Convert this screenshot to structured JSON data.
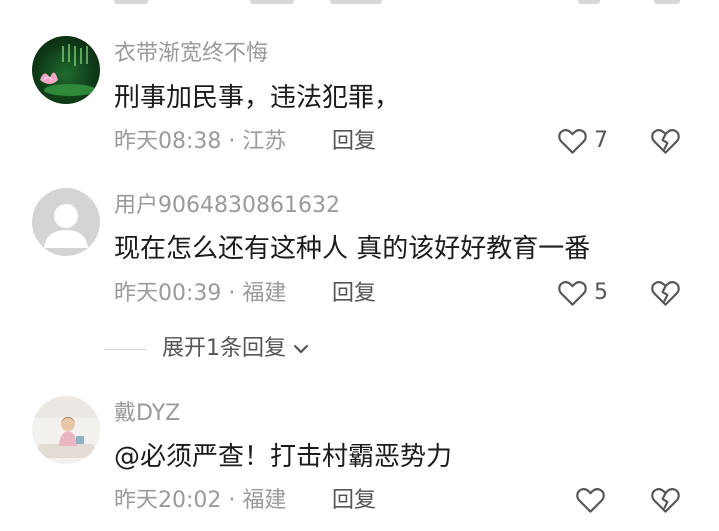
{
  "comments": [
    {
      "username": "衣带渐宽终不悔",
      "content": "刑事加民事，违法犯罪，",
      "time": "昨天08:38",
      "location": "江苏",
      "reply_label": "回复",
      "like_count": "7"
    },
    {
      "username": "用户9064830861632",
      "content": "现在怎么还有这种人 真的该好好教育一番",
      "time": "昨天00:39",
      "location": "福建",
      "reply_label": "回复",
      "like_count": "5",
      "expand_label": "展开1条回复"
    },
    {
      "username": "戴DYZ",
      "content": "@必须严查！打击村霸恶势力",
      "time": "昨天20:02",
      "location": "福建",
      "reply_label": "回复",
      "like_count": ""
    }
  ],
  "separator": " · ",
  "icons": {
    "like": "heart-outline-icon",
    "dislike": "broken-heart-icon",
    "expand": "chevron-down-icon"
  },
  "colors": {
    "username": "#9a9a9a",
    "content": "#1b1b1b",
    "meta": "#9a9a9a",
    "action": "#555555"
  }
}
